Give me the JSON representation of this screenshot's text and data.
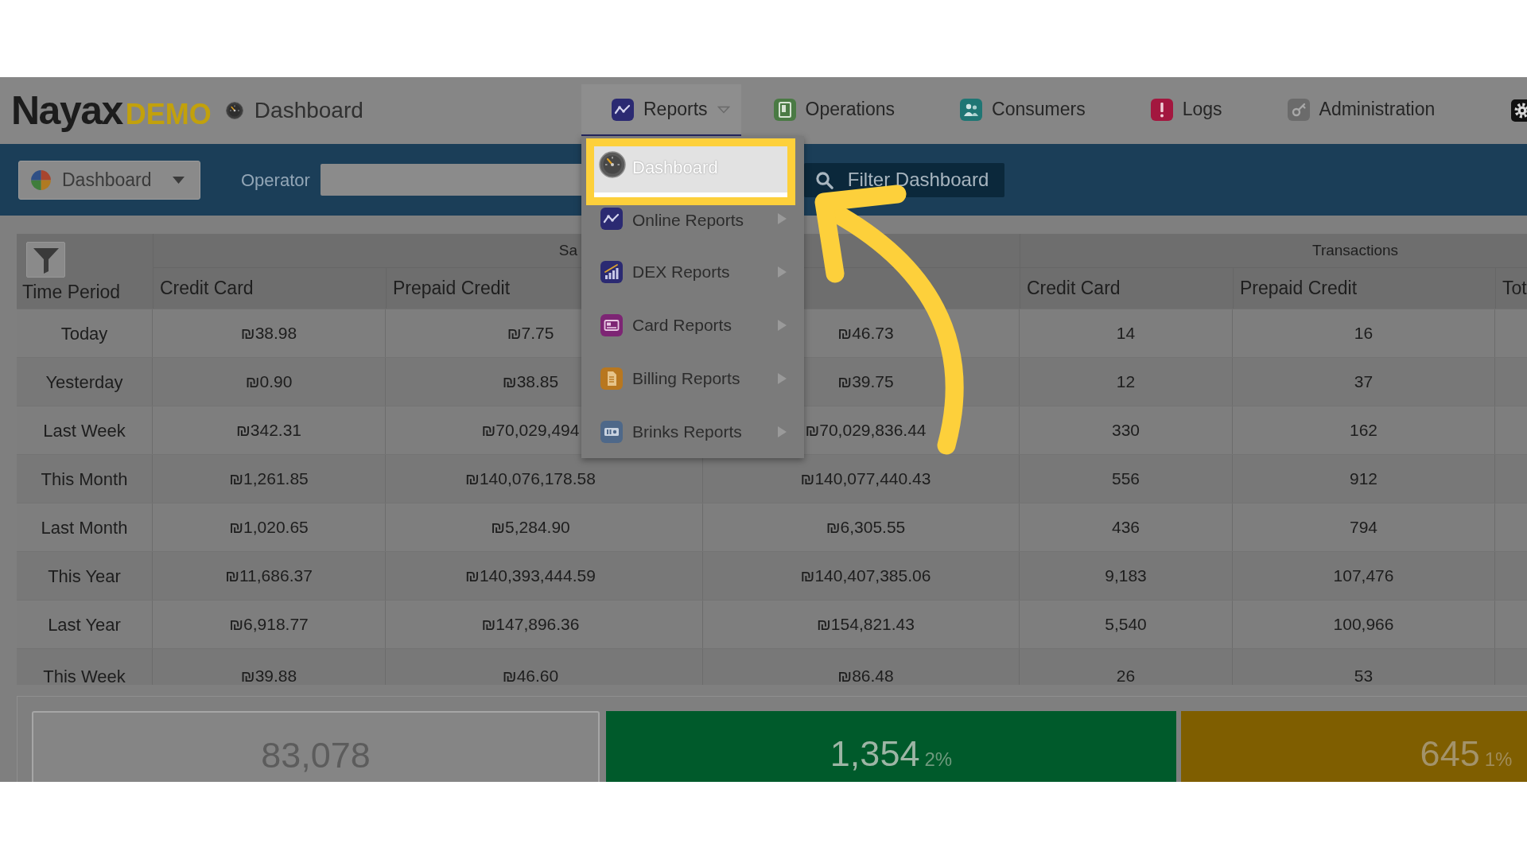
{
  "header": {
    "logo": {
      "name": "Nayax",
      "suffix": "DEMO"
    },
    "title": "Dashboard",
    "nav": [
      {
        "label": "Reports",
        "selected": true,
        "dropdown": true
      },
      {
        "label": "Operations",
        "selected": false,
        "dropdown": false
      },
      {
        "label": "Consumers",
        "selected": false,
        "dropdown": false
      },
      {
        "label": "Logs",
        "selected": false,
        "dropdown": false
      },
      {
        "label": "Administration",
        "selected": false,
        "dropdown": false
      }
    ]
  },
  "toolbar": {
    "view_select": {
      "value": "Dashboard"
    },
    "operator": {
      "label": "Operator"
    },
    "filter_button": {
      "label": "Filter Dashboard"
    }
  },
  "menu": {
    "items": [
      {
        "label": "Dashboard",
        "highlighted": true,
        "submenu": false
      },
      {
        "label": "Online Reports",
        "highlighted": false,
        "submenu": true
      },
      {
        "label": "DEX Reports",
        "highlighted": false,
        "submenu": true
      },
      {
        "label": "Card Reports",
        "highlighted": false,
        "submenu": true
      },
      {
        "label": "Billing Reports",
        "highlighted": false,
        "submenu": true
      },
      {
        "label": "Brinks Reports",
        "highlighted": false,
        "submenu": true
      }
    ]
  },
  "callout_arrow": true,
  "table": {
    "groups": [
      {
        "label": "Sa"
      },
      {
        "label": "Transactions"
      }
    ],
    "columns": [
      {
        "header": "Time Period"
      },
      {
        "header": "Credit Card"
      },
      {
        "header": "Prepaid Credit"
      },
      {},
      {
        "header": "Credit Card"
      },
      {
        "header": "Prepaid Credit"
      },
      {
        "header": "Tot"
      }
    ],
    "rows": [
      {
        "period": "Today",
        "cells": [
          "₪38.98",
          "₪7.75",
          "₪46.73",
          "14",
          "16"
        ]
      },
      {
        "period": "Yesterday",
        "cells": [
          "₪0.90",
          "₪38.85",
          "₪39.75",
          "12",
          "37"
        ]
      },
      {
        "period": "Last Week",
        "cells": [
          "₪342.31",
          "₪70,029,494",
          "₪70,029,836.44",
          "330",
          "162"
        ]
      },
      {
        "period": "This Month",
        "cells": [
          "₪1,261.85",
          "₪140,076,178.58",
          "₪140,077,440.43",
          "556",
          "912"
        ]
      },
      {
        "period": "Last Month",
        "cells": [
          "₪1,020.65",
          "₪5,284.90",
          "₪6,305.55",
          "436",
          "794"
        ]
      },
      {
        "period": "This Year",
        "cells": [
          "₪11,686.37",
          "₪140,393,444.59",
          "₪140,407,385.06",
          "9,183",
          "107,476"
        ]
      },
      {
        "period": "Last Year",
        "cells": [
          "₪6,918.77",
          "₪147,896.36",
          "₪154,821.43",
          "5,540",
          "100,966"
        ]
      },
      {
        "period": "This Week",
        "cells": [
          "₪39.88",
          "₪46.60",
          "₪86.48",
          "26",
          "53"
        ]
      }
    ]
  },
  "summary": [
    {
      "kind": "total",
      "value": "83,078"
    },
    {
      "kind": "success",
      "value": "1,354",
      "percent": "2%"
    },
    {
      "kind": "warning",
      "value": "645",
      "percent": "1%"
    }
  ]
}
